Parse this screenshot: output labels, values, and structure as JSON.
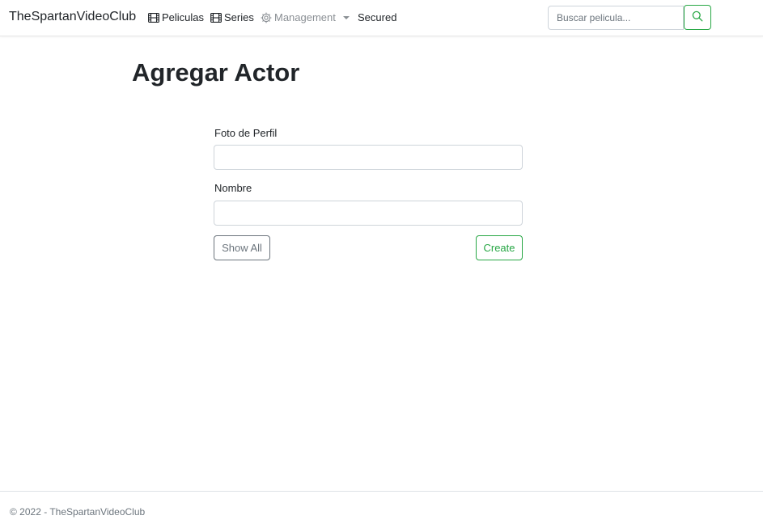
{
  "navbar": {
    "brand": "TheSpartanVideoClub",
    "links": [
      {
        "label": "Peliculas",
        "icon": "film-icon"
      },
      {
        "label": "Series",
        "icon": "film-icon"
      },
      {
        "label": "Management",
        "icon": "gear-icon",
        "dropdown": true
      },
      {
        "label": "Secured"
      }
    ],
    "search": {
      "placeholder": "Buscar pelicula...",
      "value": "",
      "icon": "search-icon"
    }
  },
  "page": {
    "title": "Agregar Actor"
  },
  "form": {
    "fields": [
      {
        "label": "Foto de Perfil",
        "value": ""
      },
      {
        "label": "Nombre",
        "value": ""
      }
    ],
    "show_all_label": "Show All",
    "create_label": "Create"
  },
  "footer": {
    "text": "© 2022 - TheSpartanVideoClub"
  },
  "colors": {
    "accent_success": "#28a745",
    "secondary": "#6c757d",
    "text": "#212529",
    "border": "#ced4da"
  }
}
